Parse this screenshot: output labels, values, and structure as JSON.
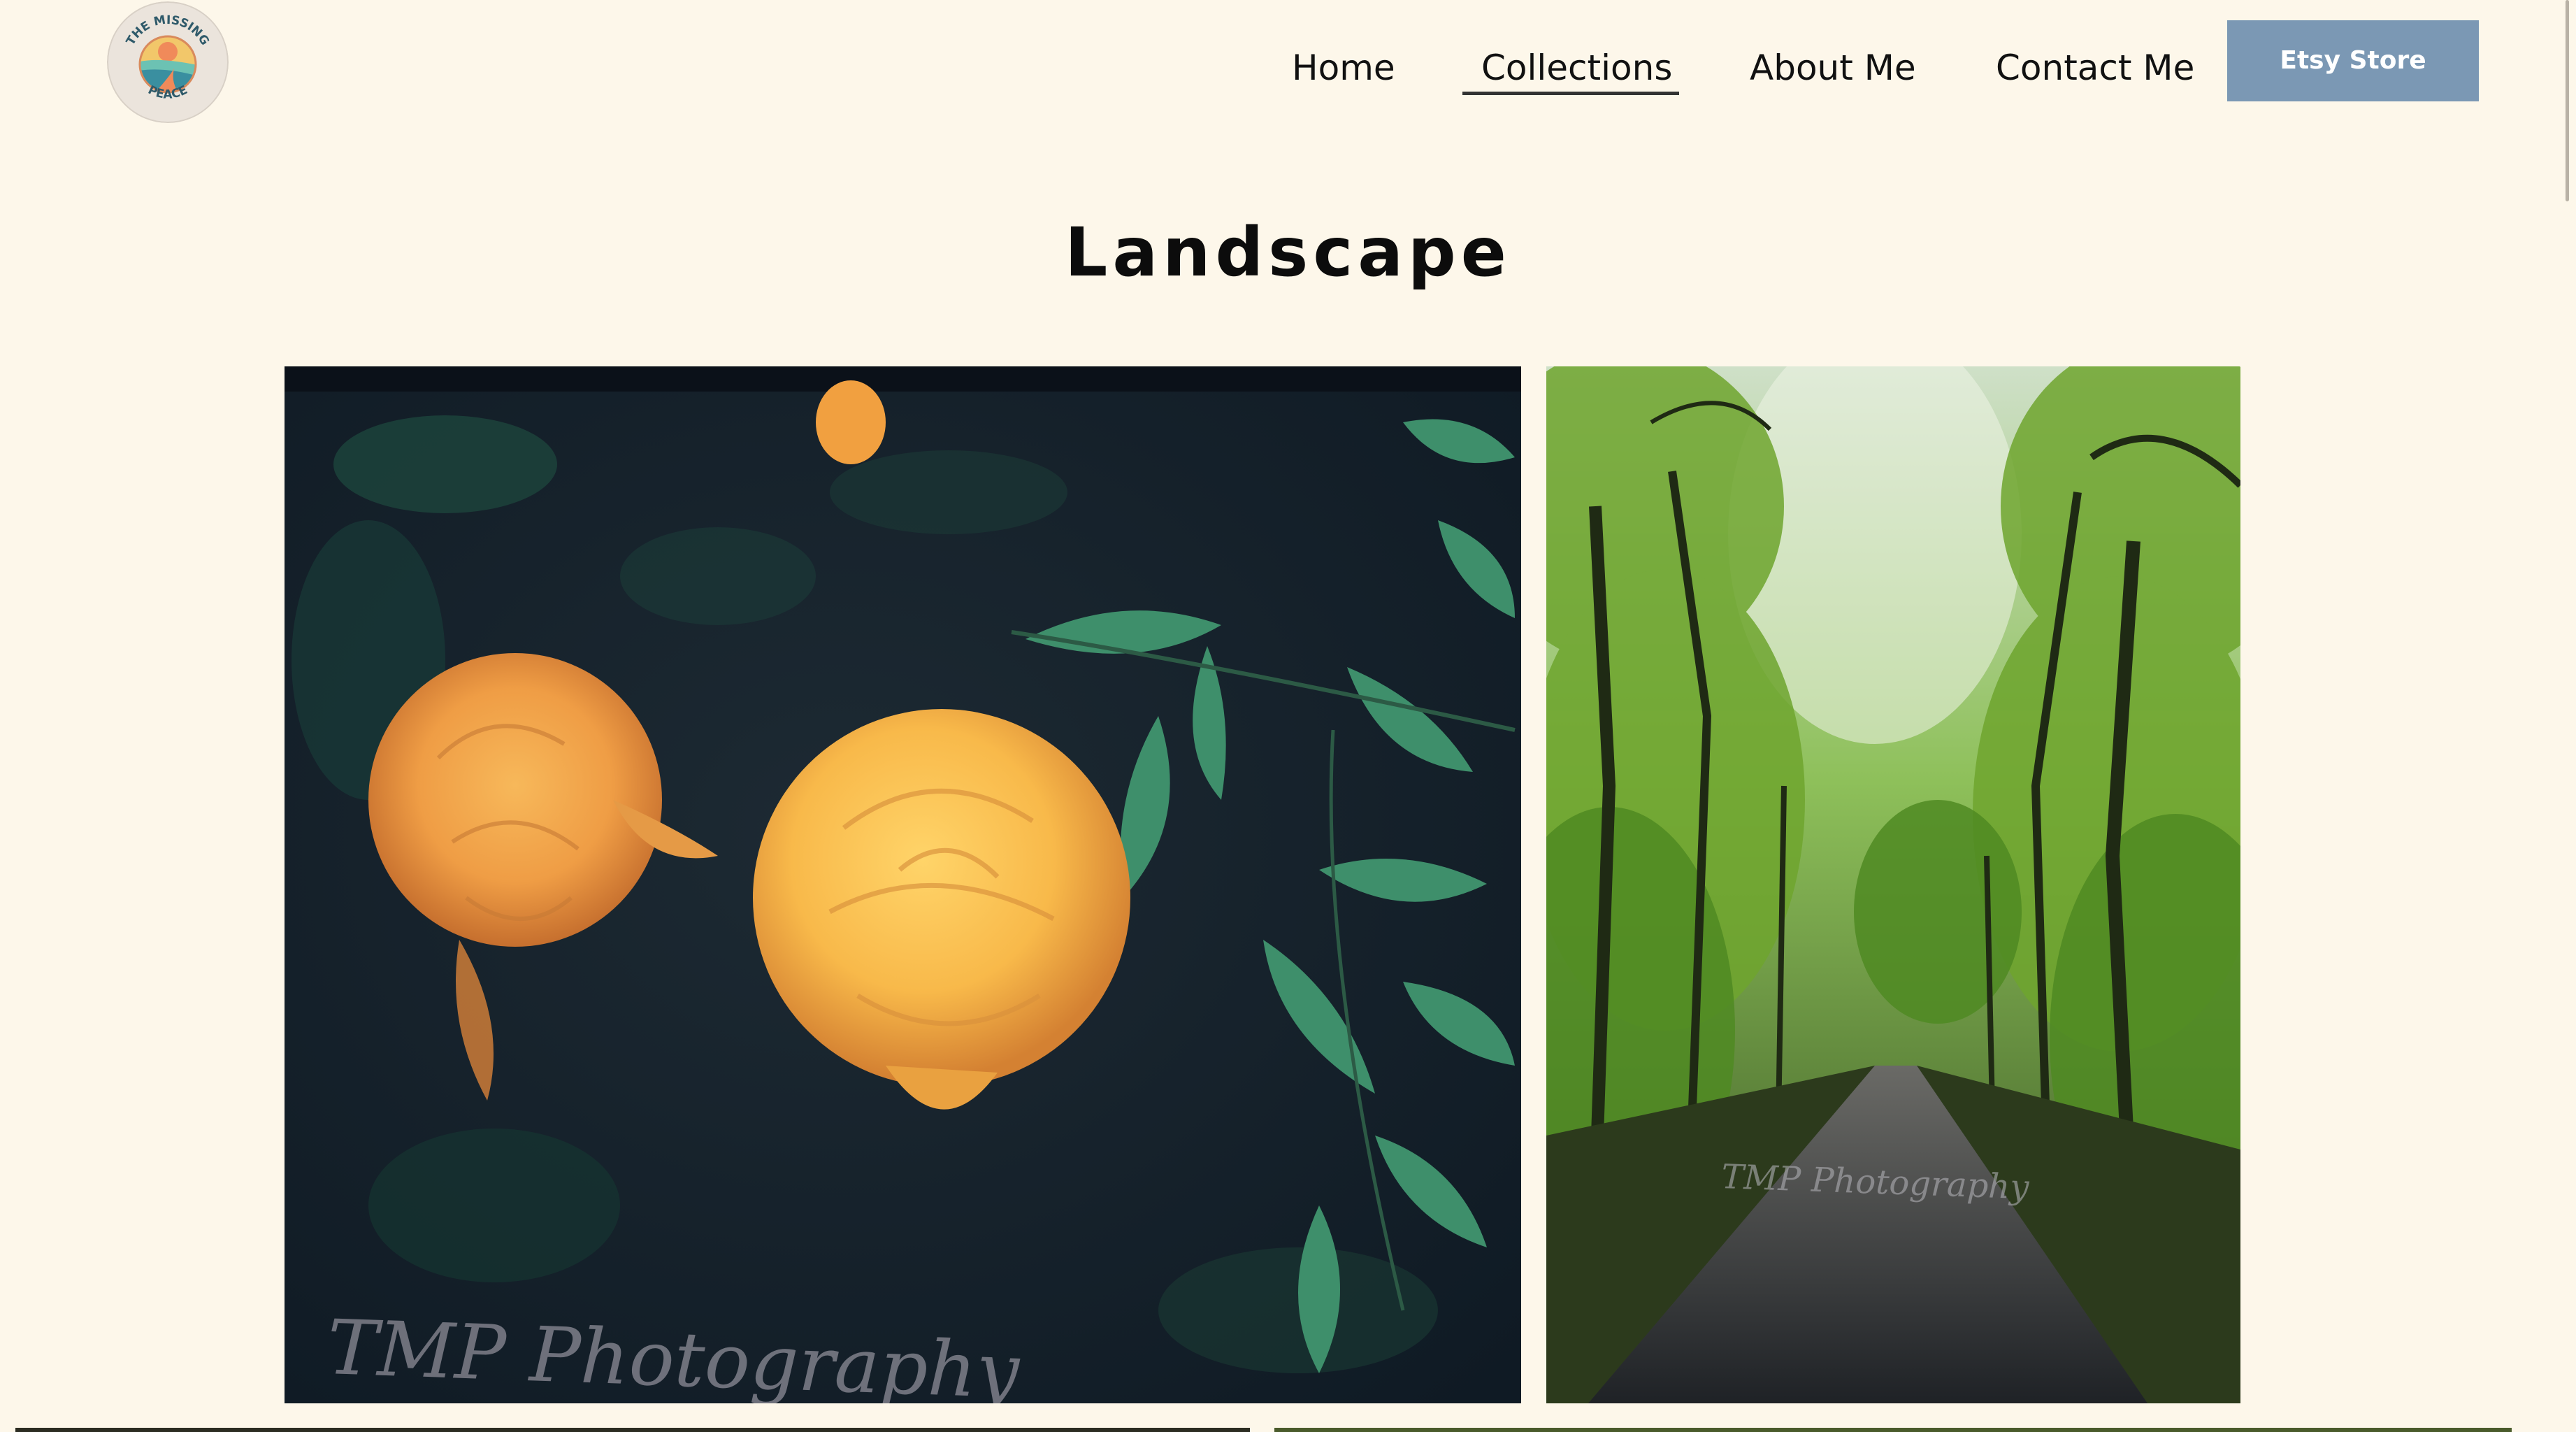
{
  "header": {
    "logo": {
      "icon": "the-missing-peace-logo",
      "text_top": "THE MISSING",
      "text_bottom": "PEACE"
    },
    "nav": [
      {
        "label": "Home"
      },
      {
        "label": "Collections",
        "active": true
      },
      {
        "label": "About Me"
      },
      {
        "label": "Contact Me"
      }
    ],
    "etsy_button": {
      "label": "Etsy Store",
      "color": "#7b98b4"
    }
  },
  "page": {
    "title": "Landscape",
    "background": "#fdf7ea"
  },
  "gallery": {
    "photos": [
      {
        "subject": "yellow-roses-with-leaves",
        "watermark": "TMP Photography"
      },
      {
        "subject": "forest-road-tree-canopy",
        "watermark": "TMP Photography"
      }
    ]
  }
}
